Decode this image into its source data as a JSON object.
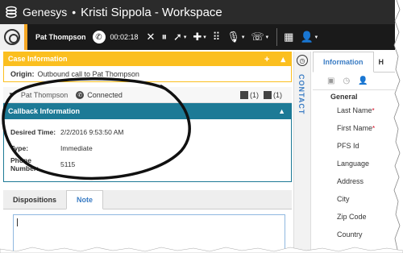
{
  "window": {
    "brand": "Genesys",
    "separator": "•",
    "title": "Kristi Sippola - Workspace"
  },
  "toolbar": {
    "contact_name": "Pat Thompson",
    "timer": "00:02:18",
    "icons": [
      "end-call-icon",
      "hold-icon",
      "transfer-icon",
      "conference-icon",
      "dialpad-icon",
      "microphone-icon",
      "consult-icon",
      "schedule-callback-icon",
      "add-contact-icon"
    ]
  },
  "case": {
    "header": "Case Information",
    "origin_label": "Origin:",
    "origin_value": "Outbound call to Pat Thompson"
  },
  "party": {
    "name": "Pat Thompson",
    "status": "Connected",
    "count1": "(1)",
    "count2": "(1)"
  },
  "callback": {
    "header": "Callback Information",
    "rows": [
      {
        "label": "Desired Time:",
        "value": "2/2/2016 9:53:50 AM"
      },
      {
        "label": "Type:",
        "value": "Immediate"
      },
      {
        "label": "Phone Number:",
        "value": "5115"
      }
    ]
  },
  "tabs": {
    "dispositions": "Dispositions",
    "note": "Note"
  },
  "contact_strip": {
    "label": "CONTACT"
  },
  "right": {
    "tab_information": "Information",
    "tab_history": "H",
    "section": "General",
    "fields": [
      "Last Name",
      "First Name",
      "PFS Id",
      "Language",
      "Address",
      "City",
      "Zip Code",
      "Country"
    ],
    "required_mark": "*"
  },
  "colors": {
    "case_header": "#fbbf1f",
    "callback_header": "#1d7a96",
    "titlebar": "#2b2b2b",
    "accent": "#3a7cc4"
  }
}
